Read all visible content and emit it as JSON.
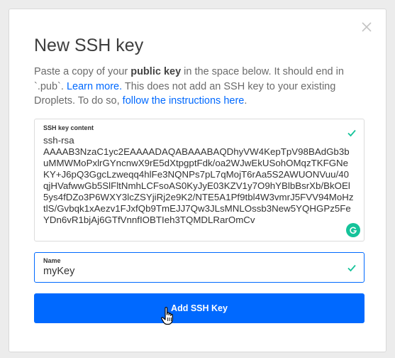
{
  "modal": {
    "title": "New SSH key",
    "close_icon": "close-icon",
    "description": {
      "part1": "Paste a copy of your ",
      "bold": "public key",
      "part2": " in the space below. It should end in `.pub`. ",
      "learn_more": "Learn more.",
      "part3": " This does not add an SSH key to your existing Droplets. To do so, ",
      "instructions_link": "follow the instructions here",
      "part4": "."
    },
    "key_field": {
      "label": "SSH key content",
      "value": "ssh-rsa\nAAAAB3NzaC1yc2EAAAADAQABAAABAQDhyVW4KepTpV98BAdGb3buMMWMoPxlrGYncnwX9rE5dXtpgptFdk/oa2WJwEkUSohOMqzTKFGNeKY+J6pQ3GgcLzweqq4hlFe3NQNPs7pL7qMojT6rAa5S2AWUONVuu/40qjHVafwwGb5SlFltNmhLCFsoAS0KyJyE03KZV1y7O9hYBlbBsrXb/BkOEl5ys4fDZo3P6WXY3lcZSYjiRj2e9K2/NTE5A1Pf9tbl4W3vmrJ5FVV94MoHztlS/Gvbqk1xAezv1FJxfQb9TmEJJ7Qw3JLsMNLOssb3New5YQHGPz5FeYDn6vR1bjAj6GTfVnnfIOBTIeh3TQMDLRarOmCv",
      "valid_icon": "check-icon",
      "grammarly_icon": "grammarly-icon"
    },
    "name_field": {
      "label": "Name",
      "value": "myKey",
      "valid_icon": "check-icon"
    },
    "submit_button": "Add SSH Key"
  },
  "colors": {
    "accent": "#0069ff",
    "valid": "#15c39a",
    "grammarly": "#15c39a"
  }
}
